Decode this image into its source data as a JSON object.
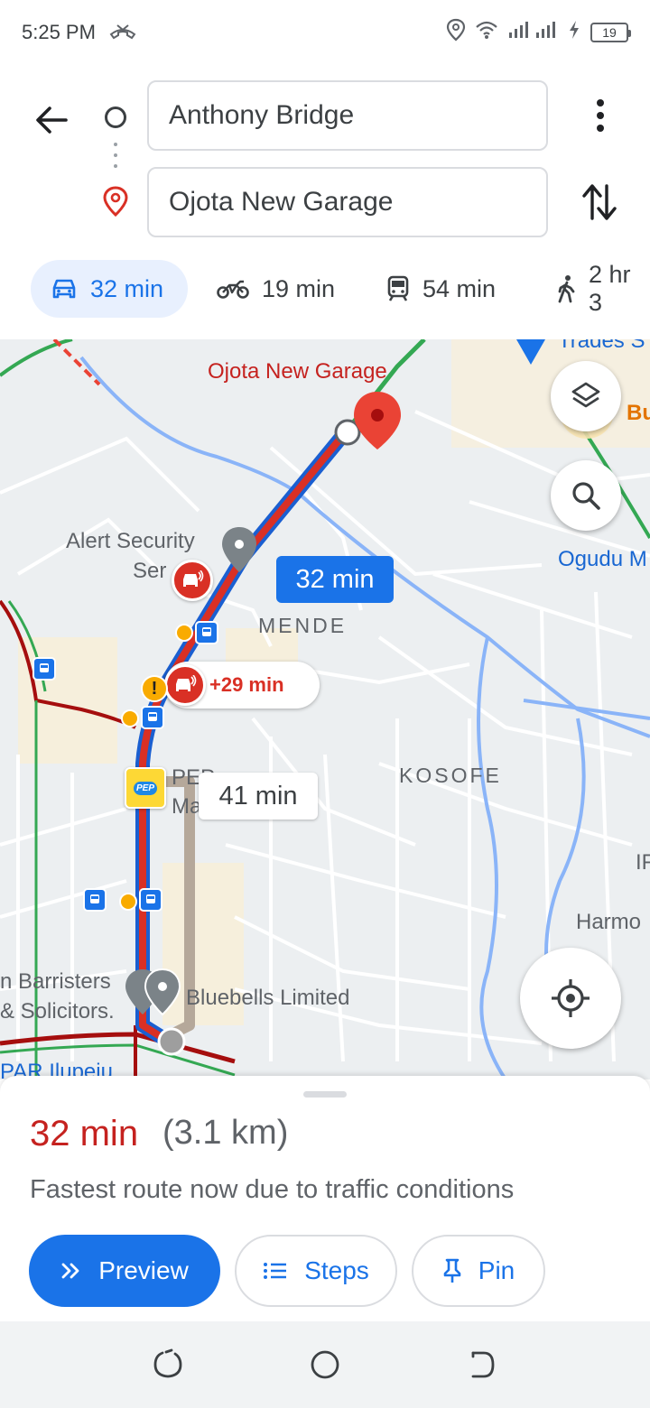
{
  "status_bar": {
    "time": "5:25 PM",
    "battery": "19"
  },
  "directions": {
    "start": "Anthony Bridge",
    "destination": "Ojota New Garage"
  },
  "modes": [
    {
      "name": "drive",
      "label": "32 min",
      "selected": true
    },
    {
      "name": "motorcycle",
      "label": "19 min"
    },
    {
      "name": "transit",
      "label": "54 min"
    },
    {
      "name": "walk",
      "label": "2 hr 3"
    }
  ],
  "map": {
    "labels": {
      "destination": "Ojota New Garage",
      "alert_security_1": "Alert Security",
      "alert_security_2": "Ser",
      "mende": "MENDE",
      "kosofe": "KOSOFE",
      "ogudu": "Ogudu M",
      "pep_1": "PEP",
      "pep_2": "Ma",
      "pep_3": "ll",
      "barristers_1": "n Barristers",
      "barristers_2": "& Solicitors.",
      "bluebells": "Bluebells Limited",
      "par_ilupeju": "PAR Ilupeju",
      "harmo": "Harmo",
      "trades": "Trades S",
      "bu": "Bu",
      "ir": "IF"
    },
    "route_time": "32 min",
    "alt_route_time": "41 min",
    "delay": "+29 min",
    "pep_logo": "PEP"
  },
  "sheet": {
    "duration": "32 min",
    "distance": "(3.1 km)",
    "description": "Fastest route now due to traffic conditions",
    "buttons": {
      "preview": "Preview",
      "steps": "Steps",
      "pin": "Pin"
    }
  },
  "colors": {
    "accent": "#1a73e8",
    "traffic_red": "#d93025",
    "route_blue": "#1a73e8"
  }
}
